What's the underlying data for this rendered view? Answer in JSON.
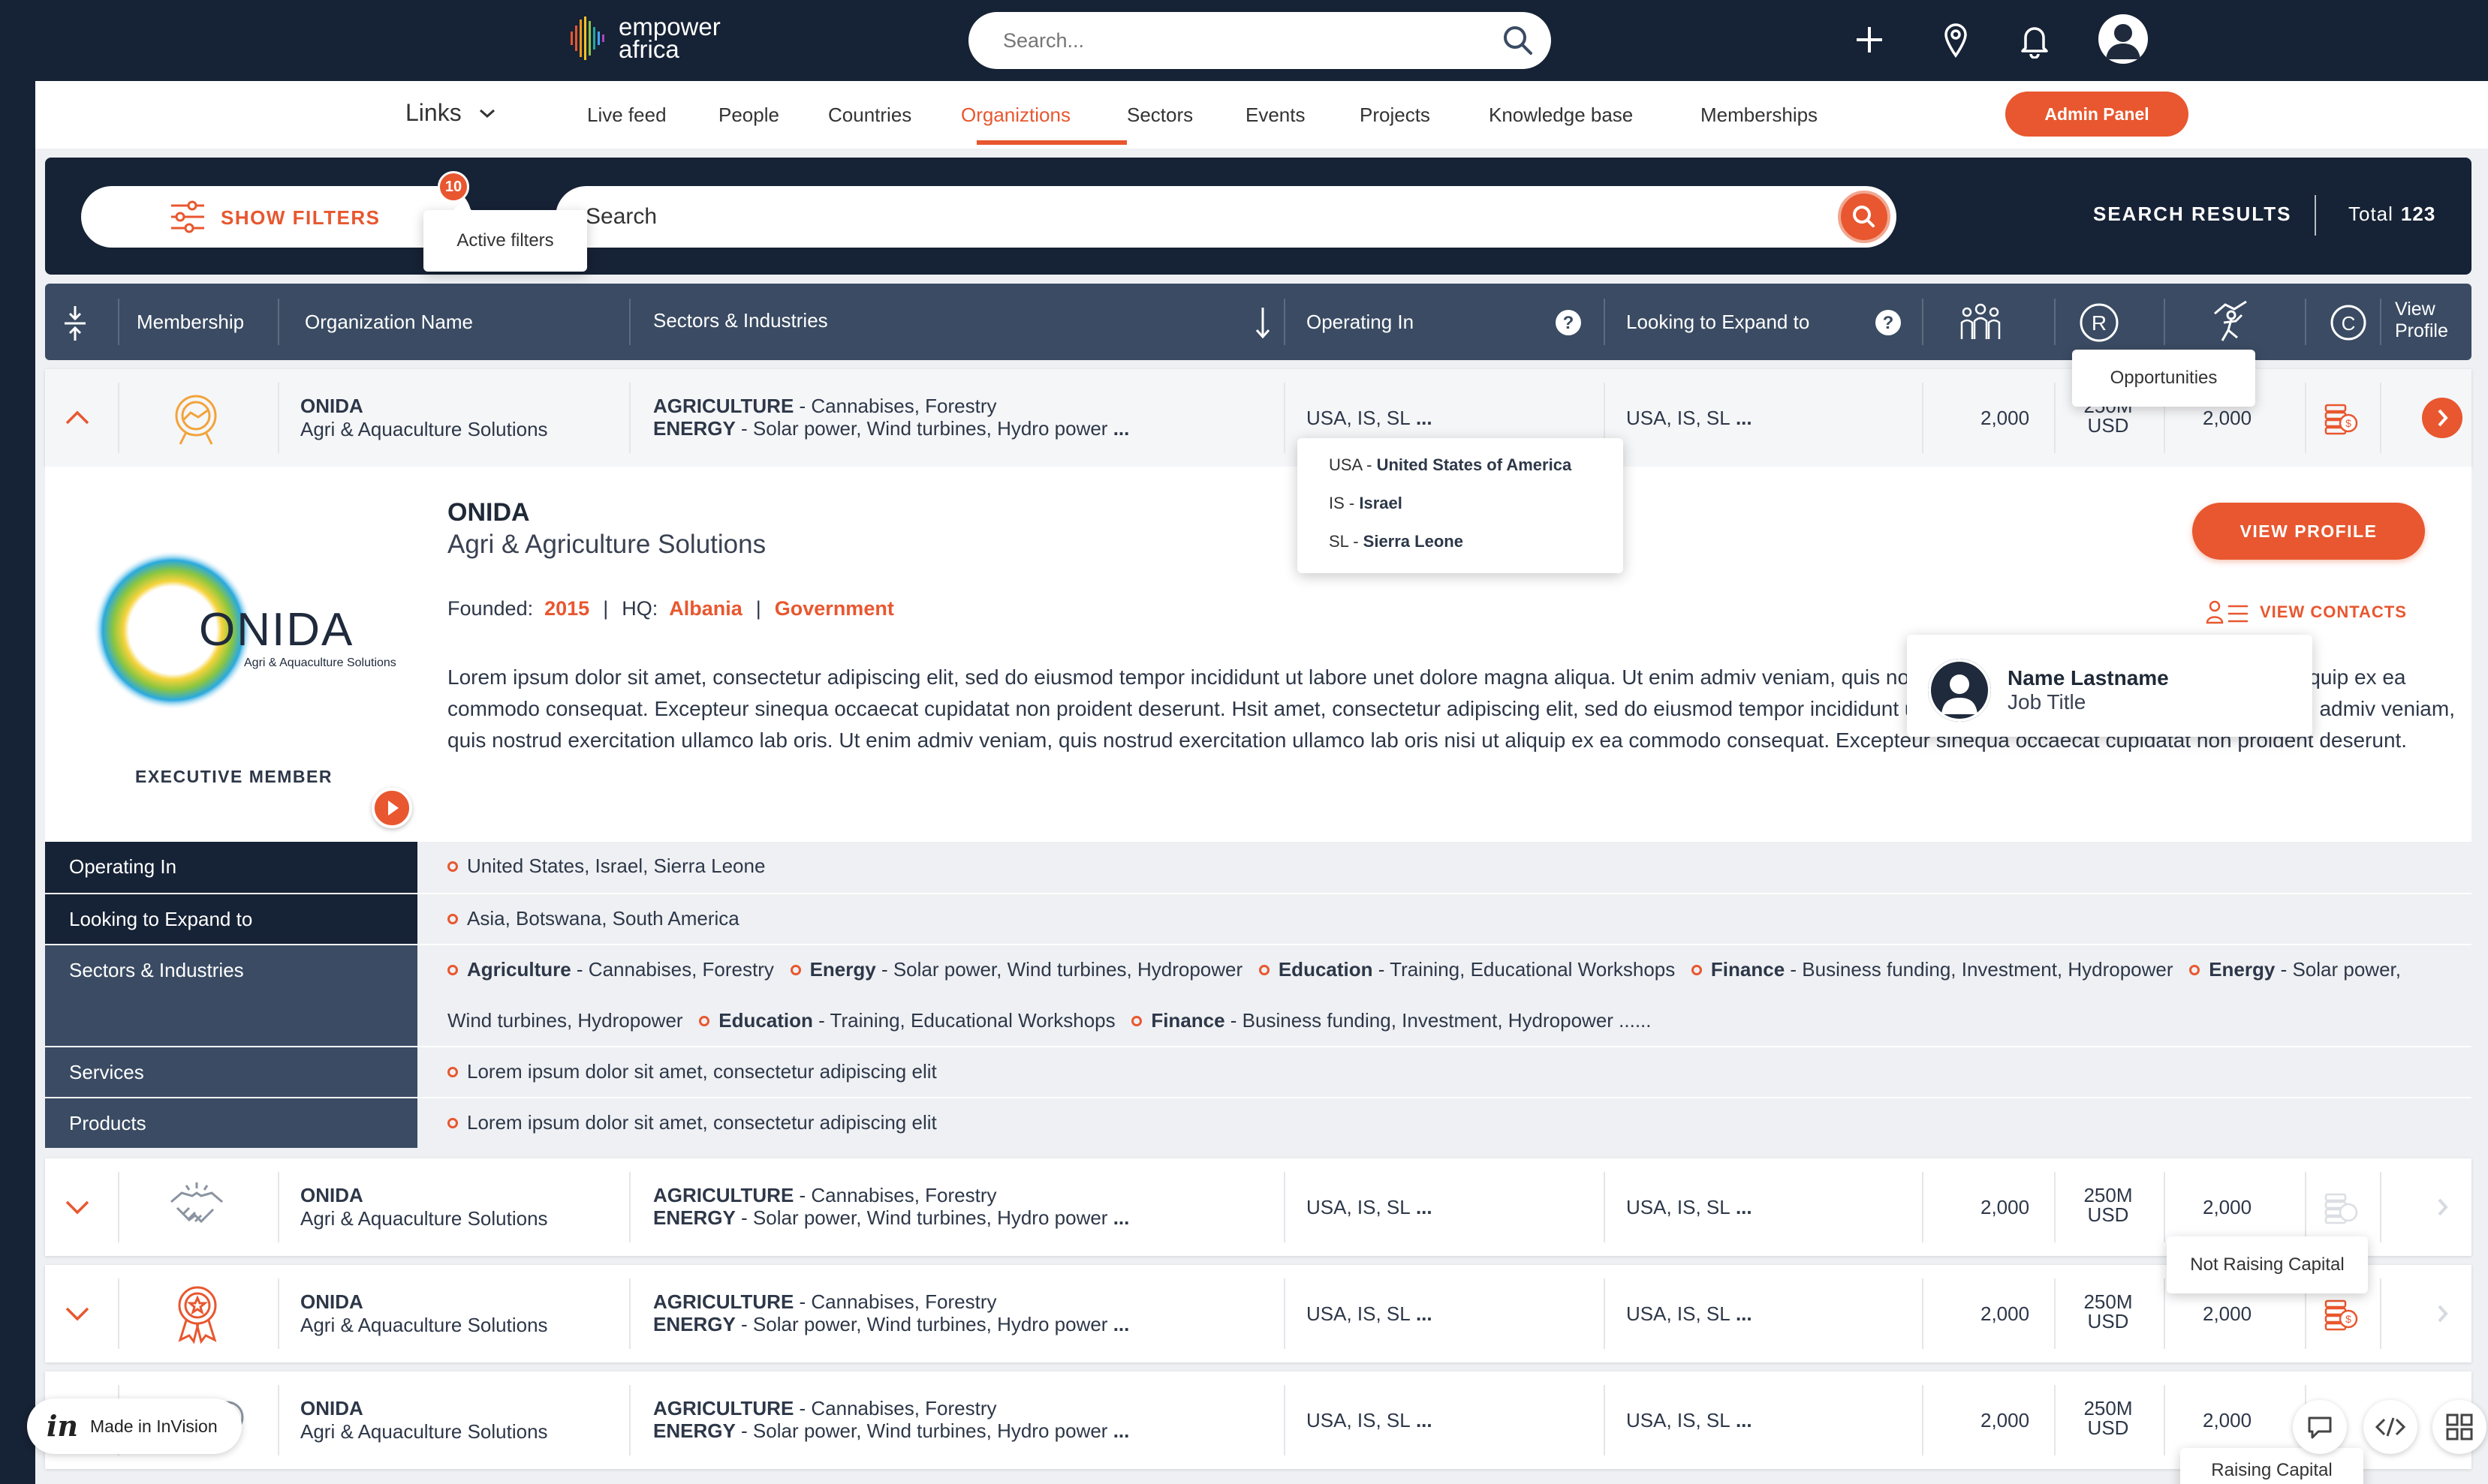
{
  "topbar": {
    "logo_line1": "empower",
    "logo_line2": "africa",
    "search_placeholder": "Search...",
    "icons": [
      "plus-icon",
      "location-pin-icon",
      "bell-icon",
      "user-avatar"
    ]
  },
  "nav": {
    "links_label": "Links",
    "items": [
      "Live feed",
      "People",
      "Countries",
      "Organiztions",
      "Sectors",
      "Events",
      "Projects",
      "Knowledge base",
      "Memberships"
    ],
    "active": "Organiztions",
    "admin_label": "Admin Panel"
  },
  "filters": {
    "show_label": "SHOW FILTERS",
    "badge": "10",
    "active_tooltip": "Active filters",
    "search_value": "Search",
    "results_label": "SEARCH RESULTS",
    "total_label": "Total",
    "total_value": "123"
  },
  "table": {
    "headers": {
      "membership": "Membership",
      "org_name": "Organization Name",
      "sectors": "Sectors & Industries",
      "operating": "Operating In",
      "expand": "Looking to Expand to",
      "view_profile_1": "View",
      "view_profile_2": "Profile"
    },
    "opportunities_tooltip": "Opportunities",
    "rows": [
      {
        "name": "ONIDA",
        "sub": "Agri & Aquaculture Solutions",
        "sec1_b": "AGRICULTURE",
        "sec1": " - Cannabises, Forestry",
        "sec2_b": "ENERGY",
        "sec2": " - Solar power, Wind turbines, Hydro power",
        "more": " ...",
        "operating": "USA, IS, SL",
        "expand": "USA, IS, SL",
        "people": "2,000",
        "raising_1": "250M",
        "raising_2": "USD",
        "opps": "2,000"
      },
      {
        "name": "ONIDA",
        "sub": "Agri & Aquaculture Solutions",
        "sec1_b": "AGRICULTURE",
        "sec1": " - Cannabises, Forestry",
        "sec2_b": "ENERGY",
        "sec2": " - Solar power, Wind turbines, Hydro power",
        "more": " ...",
        "operating": "USA, IS, SL",
        "expand": "USA, IS, SL",
        "people": "2,000",
        "raising_1": "250M",
        "raising_2": "USD",
        "opps": "2,000"
      },
      {
        "name": "ONIDA",
        "sub": "Agri & Aquaculture Solutions",
        "sec1_b": "AGRICULTURE",
        "sec1": " - Cannabises, Forestry",
        "sec2_b": "ENERGY",
        "sec2": " - Solar power, Wind turbines, Hydro power",
        "more": " ...",
        "operating": "USA, IS, SL",
        "expand": "USA, IS, SL",
        "people": "2,000",
        "raising_1": "250M",
        "raising_2": "USD",
        "opps": "2,000"
      },
      {
        "name": "ONIDA",
        "sub": "Agri & Aquaculture Solutions",
        "sec1_b": "AGRICULTURE",
        "sec1": " - Cannabises, Forestry",
        "sec2_b": "ENERGY",
        "sec2": " - Solar power, Wind turbines, Hydro power",
        "more": " ...",
        "operating": "USA, IS, SL",
        "expand": "USA, IS, SL",
        "people": "2,000",
        "raising_1": "250M",
        "raising_2": "USD",
        "opps": "2,000"
      }
    ],
    "operating_dropdown": [
      {
        "code": "USA",
        "name": "United States of America"
      },
      {
        "code": "IS",
        "name": "Israel"
      },
      {
        "code": "SL",
        "name": "Sierra Leone"
      }
    ],
    "not_raising_tooltip": "Not Raising Capital",
    "raising_tooltip": "Raising Capital"
  },
  "expanded": {
    "logo_text": "ONIDA",
    "logo_sub": "Agri & Aquaculture Solutions",
    "membership": "EXECUTIVE MEMBER",
    "title": "ONIDA",
    "subtitle": "Agri & Agriculture Solutions",
    "founded_label": "Founded:",
    "founded": "2015",
    "hq_label": "HQ:",
    "hq": "Albania",
    "type": "Government",
    "description": "Lorem ipsum dolor sit amet, consectetur adipiscing elit, sed do eiusmod tempor incididunt ut labore unet dolore magna aliqua. Ut enim admiv veniam, quis nostrud exercitation ullamco lab oris nisi ut aliquip ex ea commodo consequat. Excepteur sinequa occaecat cupidatat non proident deserunt. Hsit amet, consectetur adipiscing elit, sed do eiusmod tempor incididunt ut labore unet dolore magna aliqua. Ut enim admiv veniam, quis nostrud exercitation ullamco lab oris. Ut enim admiv veniam, quis nostrud exercitation ullamco lab oris nisi ut aliquip ex ea commodo consequat. Excepteur sinequa occaecat cupidatat non proident deserunt.",
    "view_profile": "VIEW PROFILE",
    "view_contacts": "VIEW CONTACTS",
    "contact_name": "Name Lastname",
    "contact_title": "Job Title",
    "details": {
      "operating_label": "Operating In",
      "operating": "United States, Israel, Sierra Leone",
      "expand_label": "Looking to Expand to",
      "expand": "Asia, Botswana, South America",
      "sectors_label": "Sectors & Industries",
      "sectors": [
        {
          "b": "Agriculture",
          "t": " - Cannabises, Forestry"
        },
        {
          "b": "Energy",
          "t": " - Solar power, Wind turbines, Hydropower"
        },
        {
          "b": "Education",
          "t": " - Training, Educational Workshops"
        },
        {
          "b": "Finance",
          "t": " - Business funding, Investment, Hydropower"
        },
        {
          "b": "Energy",
          "t": " - Solar power,"
        }
      ],
      "sectors_line2": [
        {
          "b": "",
          "t": "Wind turbines, Hydropower"
        },
        {
          "b": "Education",
          "t": " - Training, Educational Workshops"
        },
        {
          "b": "Finance",
          "t": " - Business funding, Investment, Hydropower ......"
        }
      ],
      "services_label": "Services",
      "services": "Lorem ipsum dolor sit amet, consectetur adipiscing elit",
      "products_label": "Products",
      "products": "Lorem ipsum dolor sit amet, consectetur adipiscing elit"
    }
  },
  "invision": {
    "logo": "in",
    "label": "Made in InVision"
  },
  "colors": {
    "accent": "#e8572f",
    "navy": "#162235",
    "header": "#3a4b63"
  }
}
